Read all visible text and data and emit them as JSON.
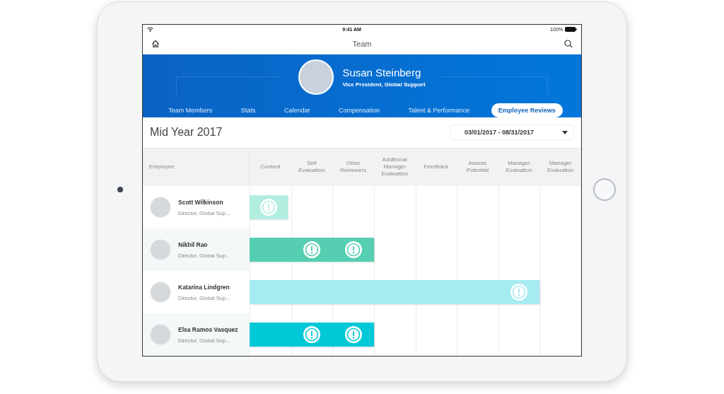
{
  "status_bar": {
    "time": "9:41 AM",
    "battery": "100%"
  },
  "nav": {
    "title": "Team"
  },
  "profile": {
    "name": "Susan Steinberg",
    "title": "Vice President, Global Support"
  },
  "tabs": [
    {
      "label": "Team Members",
      "selected": false
    },
    {
      "label": "Stats",
      "selected": false
    },
    {
      "label": "Calendar",
      "selected": false
    },
    {
      "label": "Compensation",
      "selected": false
    },
    {
      "label": "Talent & Performance",
      "selected": false
    },
    {
      "label": "Employee Reviews",
      "selected": true
    }
  ],
  "period": {
    "title": "Mid Year 2017",
    "date_range": "03/01/2017 - 08/31/2017"
  },
  "table": {
    "first_column": "Employee",
    "columns": [
      "Content",
      "Self Evaluation",
      "Other Reviewers",
      "Additional Manager Evaluation",
      "Feedback",
      "Assess Potential",
      "Manager Evaluation",
      "Manager Evaluation"
    ],
    "rows": [
      {
        "name": "Scott Wilkinson",
        "role": "Director, Global Sup...",
        "color": "#b2eee0",
        "stages": [
          {
            "kind": "alert"
          },
          {
            "kind": "none"
          },
          {
            "kind": "none"
          },
          {
            "kind": "none"
          },
          {
            "kind": "none"
          },
          {
            "kind": "none"
          },
          {
            "kind": "none"
          },
          {
            "kind": "none"
          }
        ]
      },
      {
        "name": "Nikhil Rao",
        "role": "Director, Global Sup...",
        "color": "#55ceb1",
        "stages": [
          {
            "kind": "done"
          },
          {
            "kind": "alert"
          },
          {
            "kind": "alert"
          },
          {
            "kind": "none"
          },
          {
            "kind": "none"
          },
          {
            "kind": "none"
          },
          {
            "kind": "none"
          },
          {
            "kind": "none"
          }
        ]
      },
      {
        "name": "Katarina Lindgren",
        "role": "Director, Global Sup...",
        "color": "#a6ebf2",
        "stages": [
          {
            "kind": "done"
          },
          {
            "kind": "done"
          },
          {
            "kind": "done"
          },
          {
            "kind": "done"
          },
          {
            "kind": "done"
          },
          {
            "kind": "done"
          },
          {
            "kind": "alert"
          },
          {
            "kind": "none"
          }
        ]
      },
      {
        "name": "Elsa Ramos Vasquez",
        "role": "Director, Global Sup...",
        "color": "#00c8d6",
        "stages": [
          {
            "kind": "done"
          },
          {
            "kind": "alert"
          },
          {
            "kind": "alert"
          },
          {
            "kind": "none"
          },
          {
            "kind": "none"
          },
          {
            "kind": "none"
          },
          {
            "kind": "none"
          },
          {
            "kind": "none"
          }
        ]
      }
    ]
  }
}
